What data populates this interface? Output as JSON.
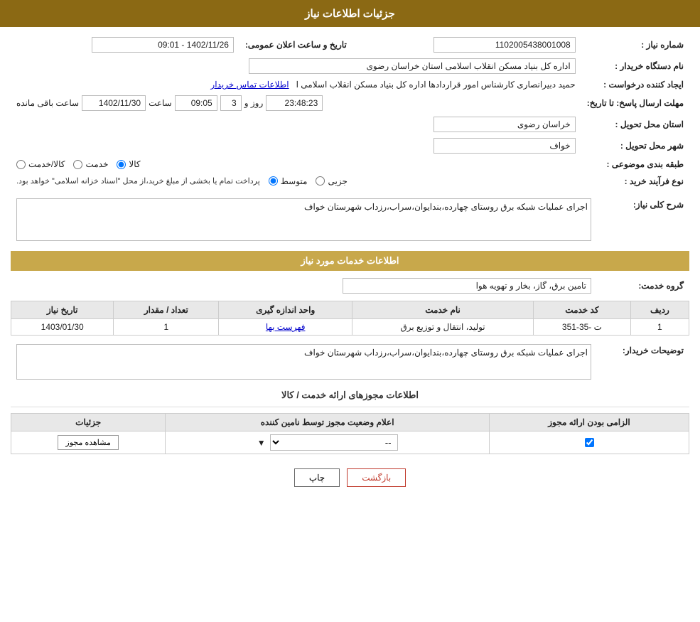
{
  "header": {
    "title": "جزئیات اطلاعات نیاز"
  },
  "info_section": {
    "shomareNiaz_label": "شماره نیاز :",
    "shomareNiaz_value": "1102005438001008",
    "namDasgahKharidar_label": "نام دستگاه خریدار :",
    "namDasgahKharidar_value": "اداره کل بنیاد مسکن انقلاب اسلامی استان خراسان رضوی",
    "iadKonande_label": "ایجاد کننده درخواست :",
    "iadKonande_value": "حمید دبیرانصاری کارشناس امور قراردادها اداره کل بنیاد مسکن انقلاب اسلامی ا",
    "iadKonande_link": "اطلاعات تماس خریدار",
    "mohlat_label": "مهلت ارسال پاسخ: تا تاریخ:",
    "tarikhElan_label": "تاریخ و ساعت اعلان عمومی:",
    "tarikhElan_value": "1402/11/26 - 09:01",
    "date_value": "1402/11/30",
    "time_value": "09:05",
    "days_value": "3",
    "remaining_value": "23:48:23",
    "remaining_suffix": "ساعت باقی مانده",
    "days_label": "روز و",
    "ostanTahvil_label": "استان محل تحویل :",
    "ostanTahvil_value": "خراسان رضوی",
    "shahrTahvil_label": "شهر محل تحویل :",
    "shahrTahvil_value": "خواف",
    "tabaqeBandi_label": "طبقه بندی موضوعی :",
    "tabaqe_options": [
      {
        "label": "کالا",
        "selected": true
      },
      {
        "label": "خدمت",
        "selected": false
      },
      {
        "label": "کالا/خدمت",
        "selected": false
      }
    ],
    "noeFarayand_label": "نوع فرآیند خرید :",
    "farayand_options": [
      {
        "label": "جزیی",
        "selected": false
      },
      {
        "label": "متوسط",
        "selected": true
      }
    ],
    "farayand_note": "پرداخت تمام یا بخشی از مبلغ خرید،از محل \"اسناد خزانه اسلامی\" خواهد بود."
  },
  "sharh_section": {
    "title": "شرح کلی نیاز:",
    "value": "اجرای عملیات شبکه برق روستای چهارده،بندایوان،سراب،رزداب شهرستان خواف"
  },
  "khadamat_section": {
    "title": "اطلاعات خدمات مورد نیاز",
    "gorohe_label": "گروه خدمت:",
    "gorohe_value": "تامین برق، گاز، بخار و تهویه هوا",
    "table": {
      "headers": [
        "ردیف",
        "کد خدمت",
        "نام خدمت",
        "واحد اندازه گیری",
        "تعداد / مقدار",
        "تاریخ نیاز"
      ],
      "rows": [
        {
          "radif": "1",
          "kod": "ت -35-351",
          "name": "تولید، انتقال و توزیع برق",
          "vahed": "فهرست بها",
          "tedad": "1",
          "tarikh": "1403/01/30"
        }
      ]
    },
    "vahed_link": "فهرست بها",
    "description": "اجرای عملیات شبکه برق روستای چهارده،بندایوان،سراب،رزداب شهرستان خواف",
    "description_label": "توضیحات خریدار:"
  },
  "mojavez_section": {
    "title": "اطلاعات مجوزهای ارائه خدمت / کالا",
    "table": {
      "headers": [
        "الزامی بودن ارائه مجوز",
        "اعلام وضعیت مجوز توسط نامین کننده",
        "جزئیات"
      ],
      "rows": [
        {
          "elzami": true,
          "vaziat_value": "--",
          "joziyat_btn": "مشاهده مجوز"
        }
      ]
    }
  },
  "buttons": {
    "print": "چاپ",
    "back": "بازگشت"
  }
}
